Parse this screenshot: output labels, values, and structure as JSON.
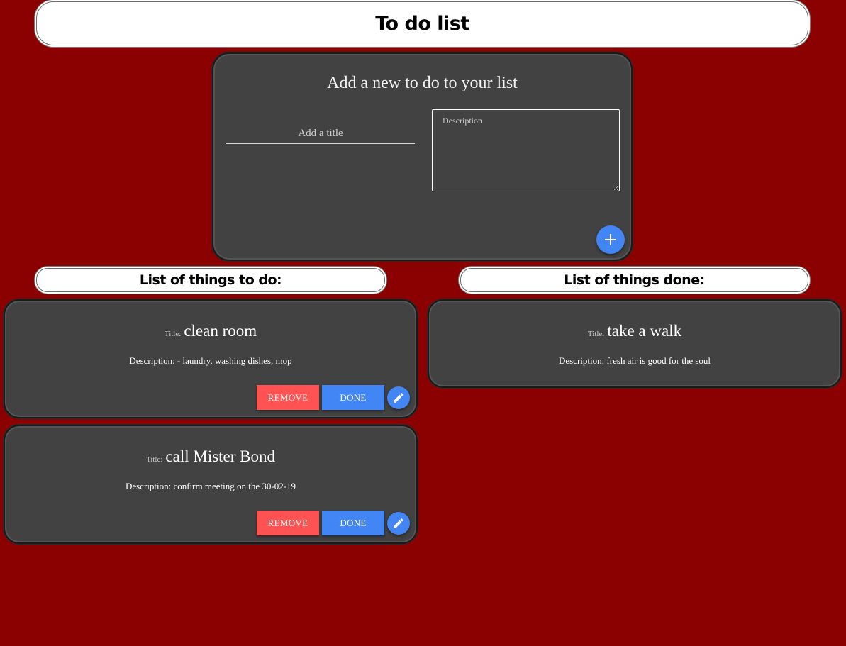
{
  "app": {
    "title": "To do list"
  },
  "add_form": {
    "heading": "Add a new to do to your list",
    "title_placeholder": "Add a title",
    "title_value": "",
    "description_placeholder": "Description",
    "description_value": "",
    "add_icon": "plus-icon"
  },
  "todo_section": {
    "header": "List of things to do:",
    "items": [
      {
        "title_label": "Title:",
        "title": "clean room",
        "description": "Description: - laundry, washing dishes, mop",
        "remove_label": "REMOVE",
        "done_label": "DONE",
        "edit_icon": "pencil-icon"
      },
      {
        "title_label": "Title:",
        "title": "call Mister Bond",
        "description": "Description: confirm meeting on the 30-02-19",
        "remove_label": "REMOVE",
        "done_label": "DONE",
        "edit_icon": "pencil-icon"
      }
    ]
  },
  "done_section": {
    "header": "List of things done:",
    "items": [
      {
        "title_label": "Title:",
        "title": "take a walk",
        "description": "Description: fresh air is good for the soul"
      }
    ]
  },
  "colors": {
    "background": "#8b0000",
    "card": "#424242",
    "primary": "#4285f4",
    "danger": "#ff5252"
  }
}
